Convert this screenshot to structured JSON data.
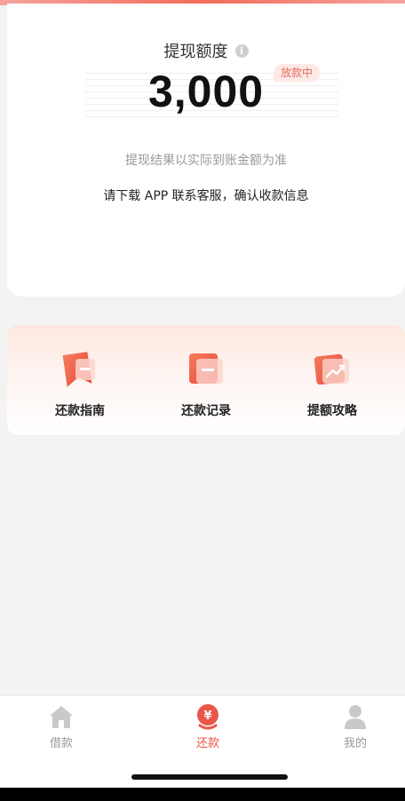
{
  "withdraw": {
    "title": "提现额度",
    "amount": "3,000",
    "status": "放款中",
    "note": "提现结果以实际到账金额为准",
    "contact": "请下载 APP 联系客服，确认收款信息"
  },
  "actions": [
    {
      "label": "还款指南",
      "icon": "bookmark-card-icon"
    },
    {
      "label": "还款记录",
      "icon": "record-card-icon"
    },
    {
      "label": "提额攻略",
      "icon": "trend-up-card-icon"
    }
  ],
  "tabbar": {
    "items": [
      {
        "label": "借款",
        "icon": "home-icon",
        "active": false
      },
      {
        "label": "还款",
        "icon": "yuan-repay-icon",
        "active": true
      },
      {
        "label": "我的",
        "icon": "user-icon",
        "active": false
      }
    ]
  },
  "colors": {
    "accent": "#e9574a",
    "badge_bg": "#fde9e6",
    "page_bg": "#f3f3f4"
  }
}
